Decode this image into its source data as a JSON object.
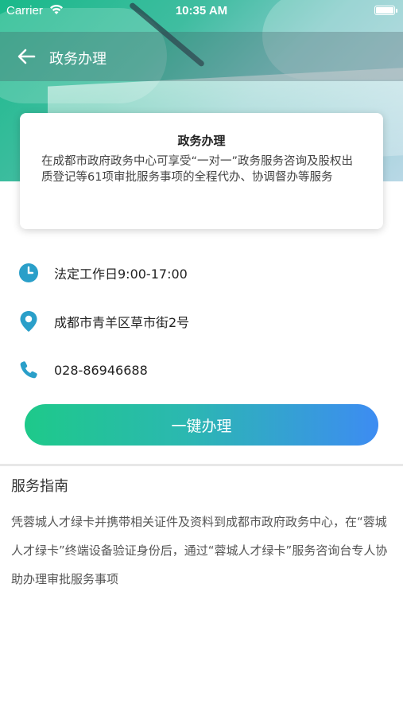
{
  "status_bar": {
    "carrier": "Carrier",
    "time": "10:35 AM"
  },
  "nav": {
    "title": "政务办理",
    "back_icon": "arrow-left-icon"
  },
  "card": {
    "title": "政务办理",
    "description": "在成都市政府政务中心可享受“一对一”政务服务咨询及股权出质登记等61项审批服务事项的全程代办、协调督办等服务"
  },
  "info": {
    "hours": "法定工作日9:00-17:00",
    "address": "成都市青羊区草市街2号",
    "phone": "028-86946688",
    "hours_icon": "clock-icon",
    "address_icon": "location-pin-icon",
    "phone_icon": "phone-icon"
  },
  "action_button": "一键办理",
  "guide": {
    "title": "服务指南",
    "text": "凭蓉城人才绿卡并携带相关证件及资料到成都市政府政务中心，在“蓉城人才绿卡”终端设备验证身份后，通过“蓉城人才绿卡”服务咨询台专人协助办理审批服务事项"
  },
  "colors": {
    "accent_green": "#1ec98a",
    "accent_blue": "#3d8cf2",
    "icon_teal": "#2a9fc9"
  }
}
